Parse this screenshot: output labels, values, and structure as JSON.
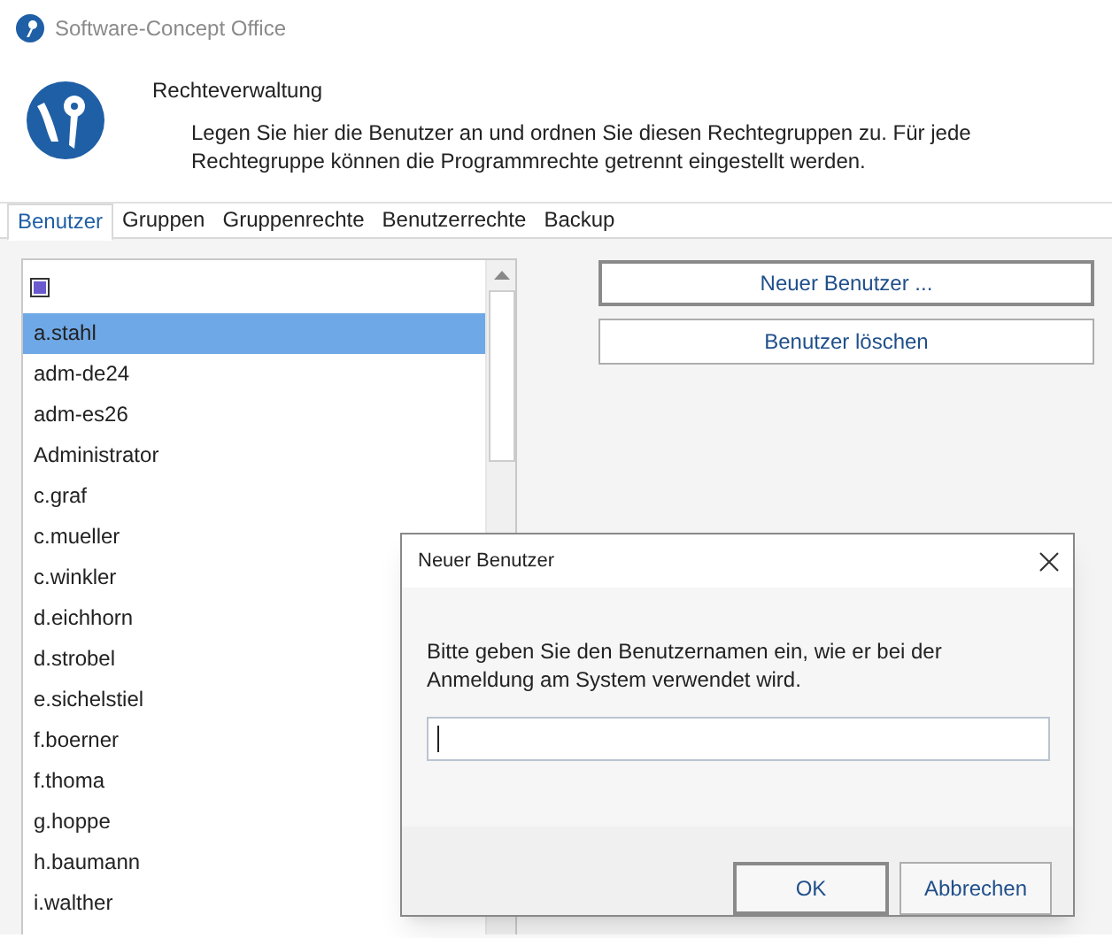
{
  "window": {
    "title": "Software-Concept Office"
  },
  "header": {
    "title": "Rechteverwaltung",
    "description": "Legen Sie hier die Benutzer an und ordnen Sie diesen Rechtegruppen zu. Für jede Rechtegruppe können die Programmrechte getrennt eingestellt werden."
  },
  "tabs": [
    {
      "label": "Benutzer",
      "selected": true
    },
    {
      "label": "Gruppen",
      "selected": false
    },
    {
      "label": "Gruppenrechte",
      "selected": false
    },
    {
      "label": "Benutzerrechte",
      "selected": false
    },
    {
      "label": "Backup",
      "selected": false
    }
  ],
  "user_list": {
    "select_all": {
      "indeterminate": true
    },
    "items": [
      {
        "label": "a.stahl",
        "selected": true
      },
      {
        "label": "adm-de24",
        "selected": false
      },
      {
        "label": "adm-es26",
        "selected": false
      },
      {
        "label": "Administrator",
        "selected": false
      },
      {
        "label": "c.graf",
        "selected": false
      },
      {
        "label": "c.mueller",
        "selected": false
      },
      {
        "label": "c.winkler",
        "selected": false
      },
      {
        "label": "d.eichhorn",
        "selected": false
      },
      {
        "label": "d.strobel",
        "selected": false
      },
      {
        "label": "e.sichelstiel",
        "selected": false
      },
      {
        "label": "f.boerner",
        "selected": false
      },
      {
        "label": "f.thoma",
        "selected": false
      },
      {
        "label": "g.hoppe",
        "selected": false
      },
      {
        "label": "h.baumann",
        "selected": false
      },
      {
        "label": "i.walther",
        "selected": false
      }
    ]
  },
  "buttons": [
    "Neuer Benutzer ...",
    "Benutzer löschen"
  ],
  "dialog": {
    "title": "Neuer Benutzer",
    "message": "Bitte geben Sie den Benutzernamen ein, wie er bei der Anmeldung am System verwendet wird.",
    "buttons": [
      "OK",
      "Abbrechen"
    ]
  }
}
